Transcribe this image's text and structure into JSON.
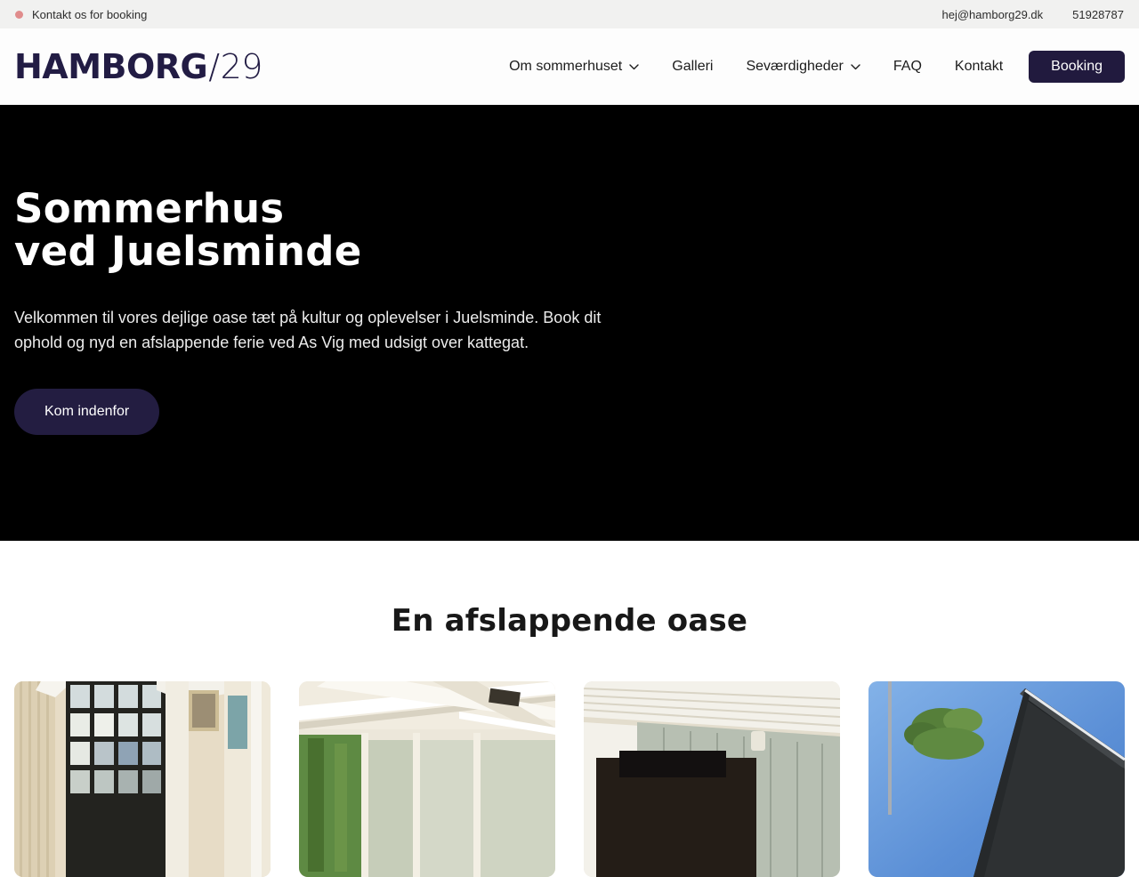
{
  "topbar": {
    "message": "Kontakt os for booking",
    "email": "hej@hamborg29.dk",
    "phone": "51928787"
  },
  "header": {
    "logo": {
      "name": "HAMBORG",
      "slash": "/",
      "number": "29"
    },
    "nav": [
      {
        "label": "Om sommerhuset",
        "has_dropdown": true
      },
      {
        "label": "Galleri",
        "has_dropdown": false
      },
      {
        "label": "Seværdigheder",
        "has_dropdown": true
      },
      {
        "label": "FAQ",
        "has_dropdown": false
      },
      {
        "label": "Kontakt",
        "has_dropdown": false
      }
    ],
    "booking_button": "Booking"
  },
  "hero": {
    "title_line1": "Sommerhus",
    "title_line2": "ved Juelsminde",
    "paragraph": "Velkommen til vores dejlige oase tæt på kultur og oplevelser i Juelsminde. Book dit ophold og nyd en afslappende ferie ved As Vig med udsigt over kattegat.",
    "cta_label": "Kom indenfor"
  },
  "oasis": {
    "heading": "En afslappende oase",
    "images": [
      {
        "name": "interior-grid-window"
      },
      {
        "name": "sunroom-ceiling-beams"
      },
      {
        "name": "slatted-ceiling-interior"
      },
      {
        "name": "house-exterior-blue-sky"
      }
    ]
  },
  "icons": {
    "chevron_down": "chevron-down-icon",
    "status_dot": "booking-status-dot"
  },
  "colors": {
    "brand_navy": "#211a3e",
    "accent_dot": "#e08c8c",
    "topbar_bg": "#f1f1f0",
    "hero_bg": "#000000"
  }
}
